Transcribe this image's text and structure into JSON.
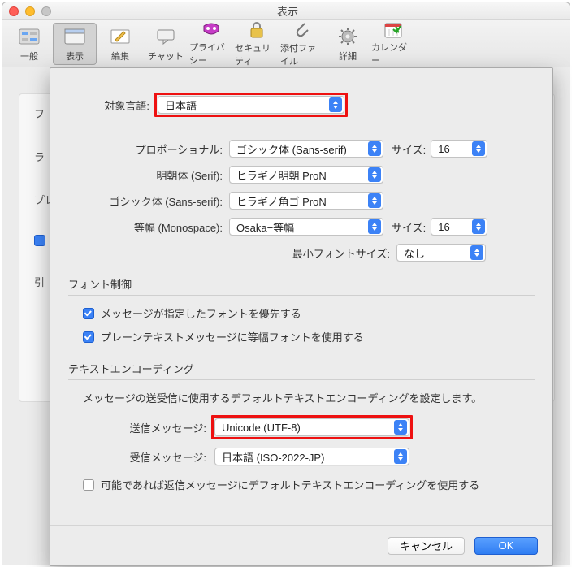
{
  "window": {
    "title": "表示"
  },
  "toolbar": {
    "items": [
      {
        "label": "一般"
      },
      {
        "label": "表示"
      },
      {
        "label": "編集"
      },
      {
        "label": "チャット"
      },
      {
        "label": "プライバシー"
      },
      {
        "label": "セキュリティ"
      },
      {
        "label": "添付ファイル"
      },
      {
        "label": "詳細"
      },
      {
        "label": "カレンダー"
      }
    ]
  },
  "bg": {
    "line1": "フ",
    "line2": "ラ",
    "line3_prefix": "プレ",
    "line4_prefix": "引"
  },
  "lang": {
    "label": "対象言語:",
    "value": "日本語"
  },
  "fonts": {
    "proportional_label": "プロポーショナル:",
    "proportional_value": "ゴシック体 (Sans-serif)",
    "serif_label": "明朝体 (Serif):",
    "serif_value": "ヒラギノ明朝 ProN",
    "sans_label": "ゴシック体 (Sans-serif):",
    "sans_value": "ヒラギノ角ゴ ProN",
    "mono_label": "等幅 (Monospace):",
    "mono_value": "Osaka−等幅",
    "size_label": "サイズ:",
    "size1": "16",
    "size2": "16",
    "minsize_label": "最小フォントサイズ:",
    "minsize_value": "なし"
  },
  "fontctrl": {
    "heading": "フォント制御",
    "opt1": "メッセージが指定したフォントを優先する",
    "opt2": "プレーンテキストメッセージに等幅フォントを使用する"
  },
  "encoding": {
    "heading": "テキストエンコーディング",
    "desc": "メッセージの送受信に使用するデフォルトテキストエンコーディングを設定します。",
    "send_label": "送信メッセージ:",
    "send_value": "Unicode (UTF-8)",
    "recv_label": "受信メッセージ:",
    "recv_value": "日本語 (ISO-2022-JP)",
    "reply_default": "可能であれば返信メッセージにデフォルトテキストエンコーディングを使用する"
  },
  "buttons": {
    "cancel": "キャンセル",
    "ok": "OK"
  }
}
